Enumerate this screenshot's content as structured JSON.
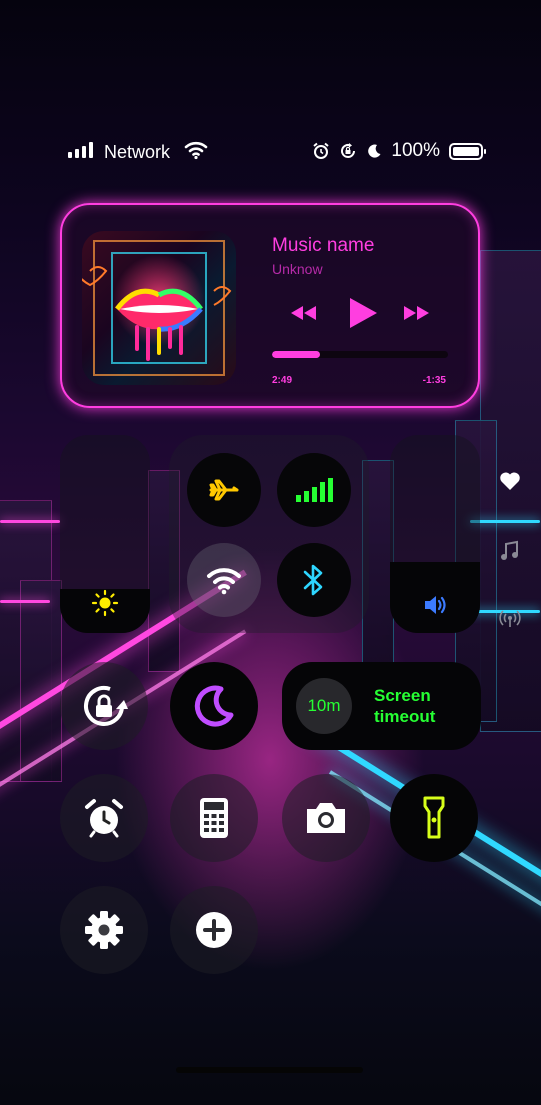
{
  "status_bar": {
    "network_label": "Network",
    "battery_percent": "100%",
    "icons": [
      "signal-bars-icon",
      "wifi-icon",
      "alarm-icon",
      "rotation-lock-icon",
      "moon-icon",
      "battery-icon"
    ]
  },
  "music": {
    "title": "Music name",
    "artist": "Unknow",
    "elapsed": "2:49",
    "remaining": "-1:35",
    "progress_fraction": 0.27,
    "accent_color": "#ff3ee0",
    "icons": [
      "album-art",
      "rewind-icon",
      "play-icon",
      "fast-forward-icon"
    ]
  },
  "brightness": {
    "level_fraction": 0.22,
    "icon": "sun-icon",
    "icon_color": "#ffee00"
  },
  "volume": {
    "level_fraction": 0.36,
    "icon": "speaker-icon",
    "icon_color": "#3c7bff"
  },
  "connectivity": {
    "airplane": {
      "icon": "airplane-icon",
      "color": "#ffc800"
    },
    "mobile_data": {
      "icon": "cellular-bars-icon",
      "color": "#26ff33"
    },
    "wifi": {
      "icon": "wifi-icon",
      "color": "#ffffff"
    },
    "bluetooth": {
      "icon": "bluetooth-icon",
      "color": "#2ed6ff"
    }
  },
  "screen_timeout": {
    "value": "10m",
    "label": "Screen timeout",
    "color": "#26ff33"
  },
  "toggles": {
    "rotation_lock": "rotation-lock-icon",
    "do_not_disturb": {
      "icon": "moon-icon",
      "color": "#c04dff"
    },
    "alarm": "alarm-clock-icon",
    "calculator": "calculator-icon",
    "camera": "camera-icon",
    "flashlight": {
      "icon": "flashlight-icon",
      "color": "#d8ff1a"
    },
    "settings": "gear-icon",
    "add": "plus-icon"
  },
  "side_icons": [
    "heart-icon",
    "music-note-icon",
    "broadcast-icon"
  ]
}
